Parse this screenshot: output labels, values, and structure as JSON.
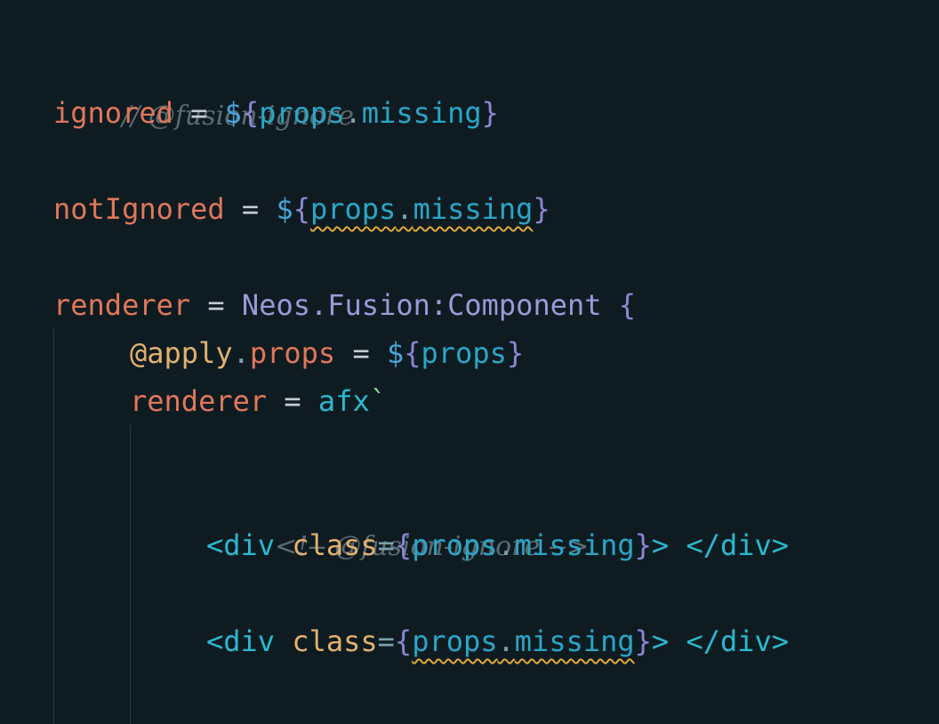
{
  "colors": {
    "background": "#0e1c22",
    "key": "#e0775a",
    "comment": "#5c6b72",
    "tag": "#2ab9cf",
    "attribute": "#e2b16d",
    "warning_squiggle": "#e2a93a"
  },
  "code": {
    "line1": {
      "comment": "// @fusion-ignore"
    },
    "line2": {
      "key": "ignored",
      "op": " = ",
      "dollar": "$",
      "open": "{",
      "obj": "props",
      "dot": ".",
      "prop": "missing",
      "close": "}"
    },
    "line3": {
      "key": "notIgnored",
      "op": " = ",
      "dollar": "$",
      "open": "{",
      "obj": "props",
      "dot": ".",
      "prop": "missing",
      "close": "}"
    },
    "line4": {
      "key": "renderer",
      "op": " = ",
      "proto": "Neos.Fusion:Component",
      "space": " ",
      "open": "{"
    },
    "line5": {
      "deco": "@apply",
      "dot": ".",
      "key": "props",
      "op": " = ",
      "dollar": "$",
      "open": "{",
      "obj": "props",
      "close": "}"
    },
    "line6": {
      "key": "renderer",
      "op": " = ",
      "afx": "afx",
      "tick": "`"
    },
    "line7": {
      "comment": "<!-- @fusion-ignore -->"
    },
    "line8": {
      "tag_open": "<div",
      "space": " ",
      "attr": "class",
      "eq": "=",
      "open": "{",
      "obj": "props",
      "dot": ".",
      "prop": "missing",
      "close": "}",
      "tag_end": ">",
      "space2": " ",
      "close_tag": "</div>"
    },
    "line9": {
      "tag_open": "<div",
      "space": " ",
      "attr": "class",
      "eq": "=",
      "open": "{",
      "obj": "props",
      "dot": ".",
      "prop": "missing",
      "close": "}",
      "tag_end": ">",
      "space2": " ",
      "close_tag": "</div>"
    }
  }
}
